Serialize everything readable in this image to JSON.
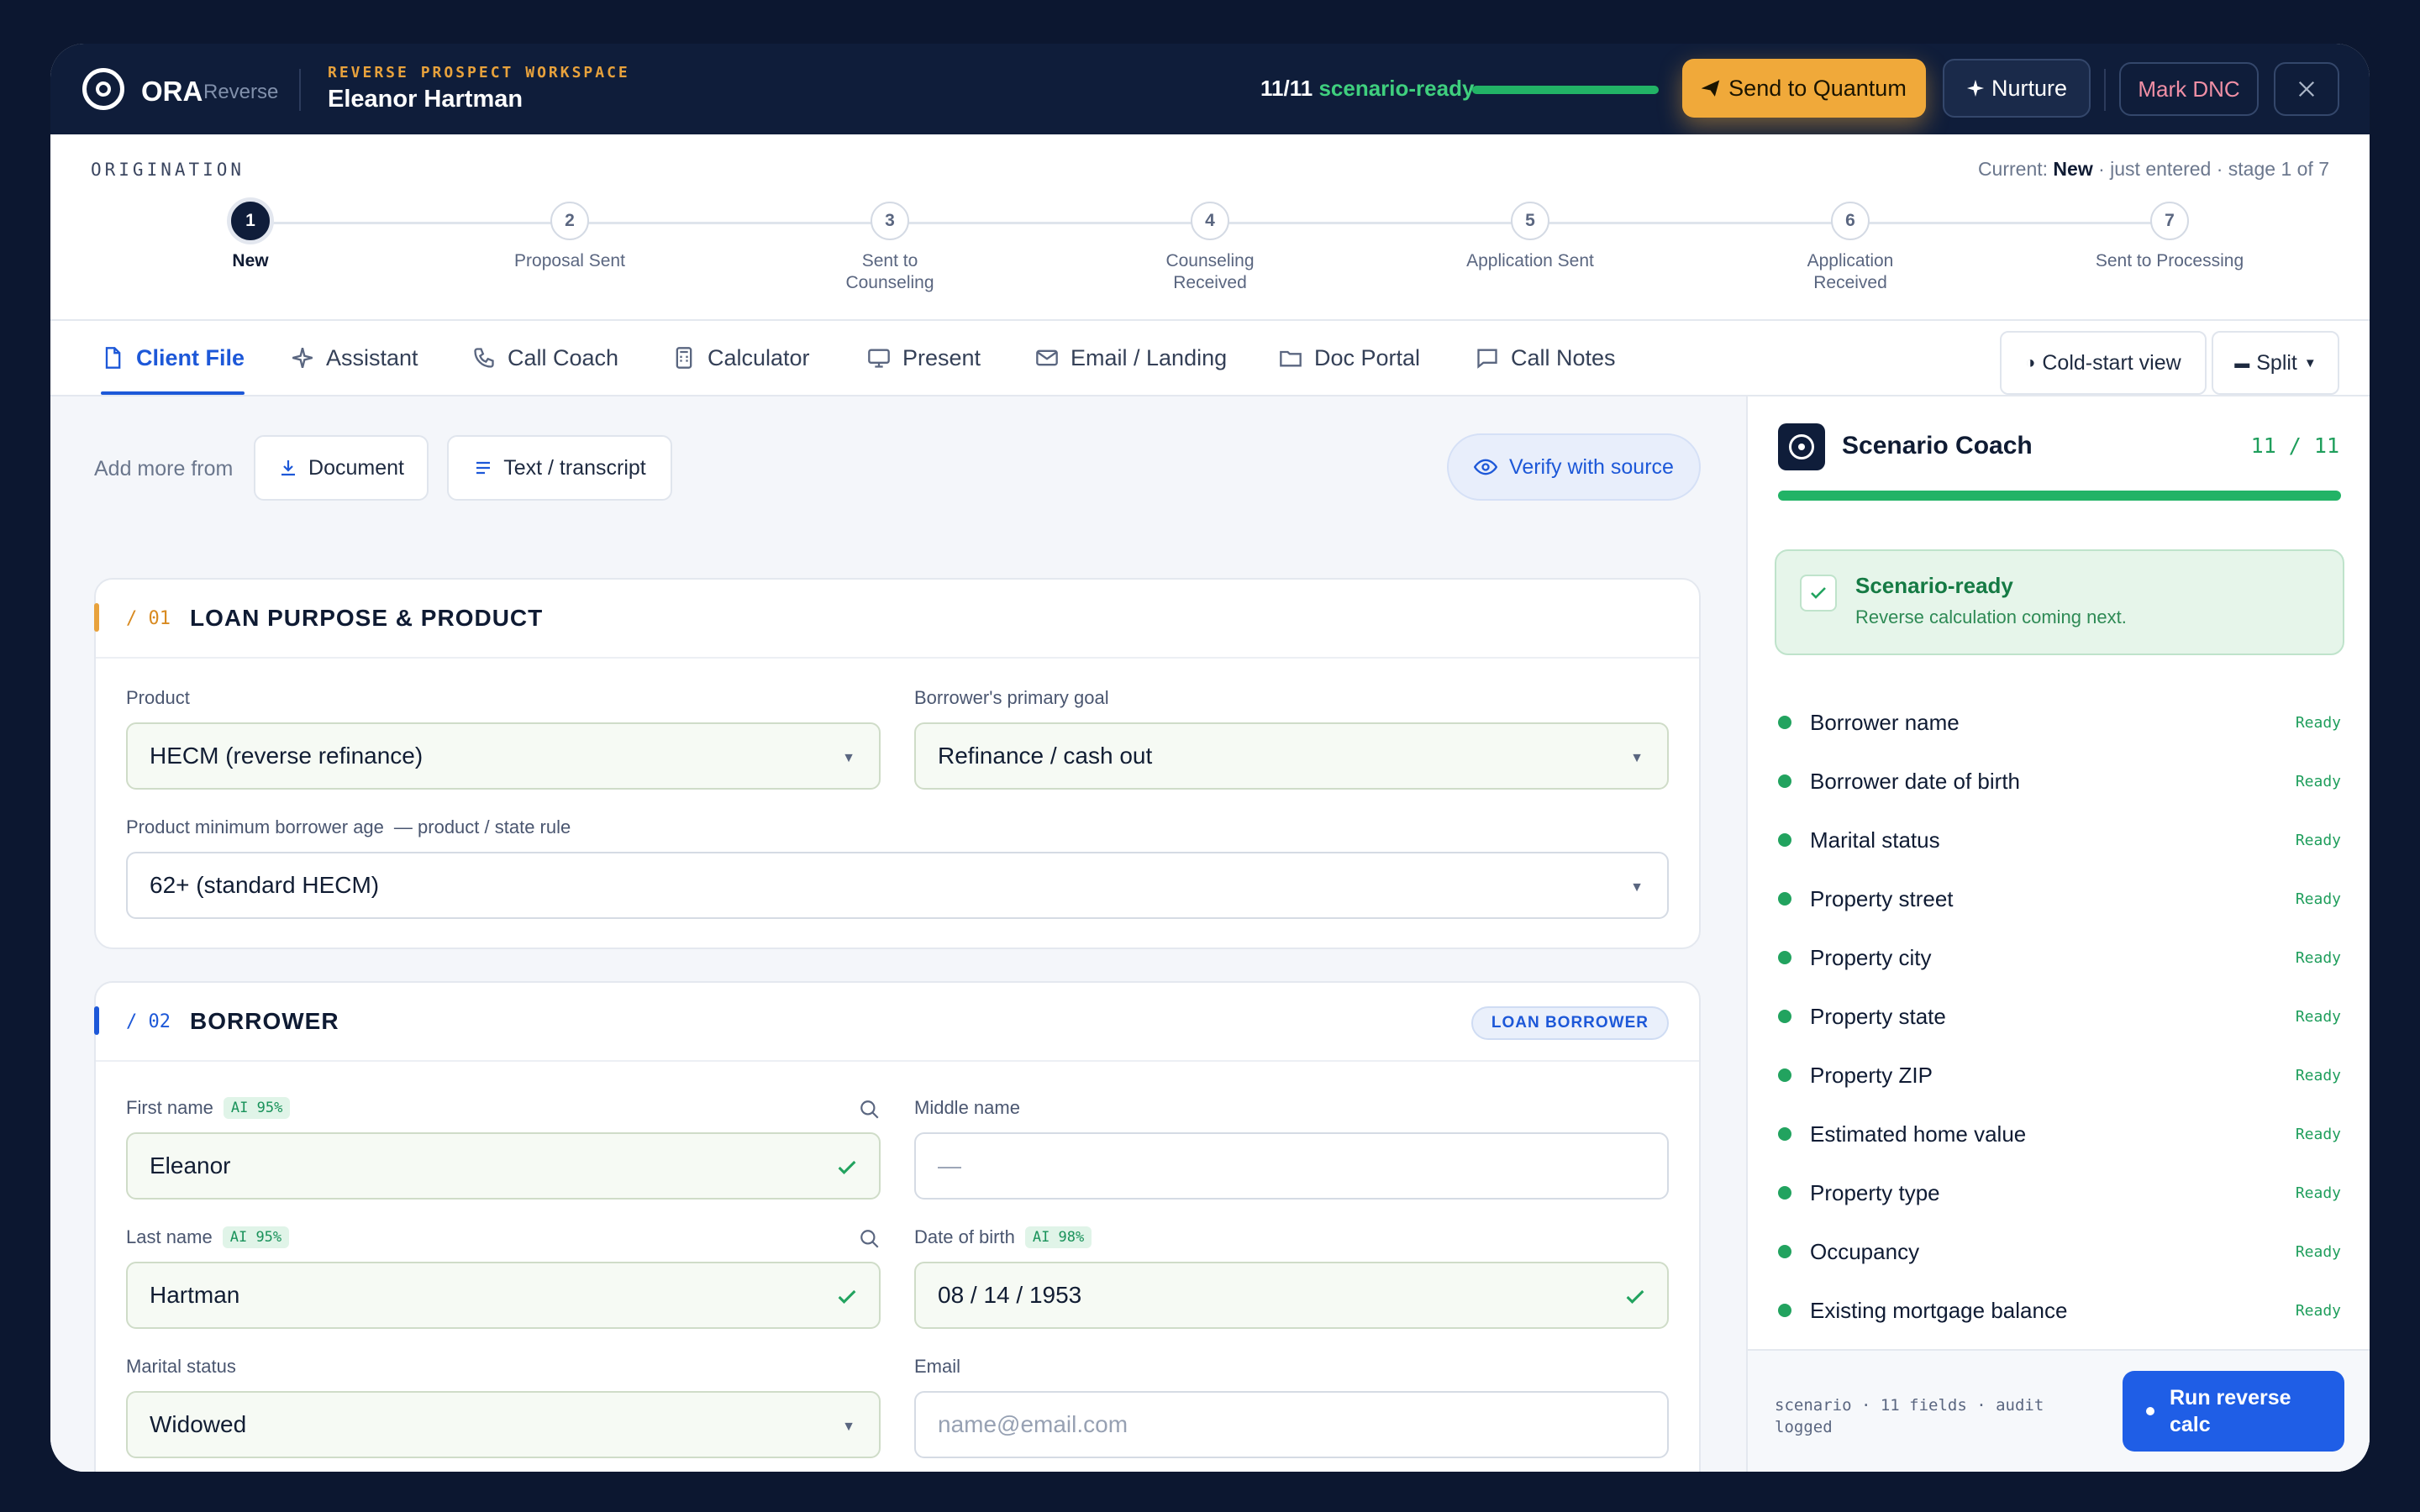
{
  "header": {
    "brand": "ORA",
    "brand_sub": "Reverse",
    "workspace_label": "REVERSE PROSPECT WORKSPACE",
    "client_name": "Eleanor Hartman",
    "ready_count": "11/11",
    "ready_label": "scenario-ready",
    "ready_progress": 1.0,
    "send_label": "Send to Quantum",
    "nurture_label": "Nurture",
    "dnc_label": "Mark DNC"
  },
  "origination": {
    "label": "ORIGINATION",
    "current_prefix": "Current:",
    "current_stage": "New",
    "current_suffix": "· just entered · stage 1 of 7",
    "steps": [
      {
        "n": "1",
        "label": "New"
      },
      {
        "n": "2",
        "label": "Proposal Sent"
      },
      {
        "n": "3",
        "label": "Sent to\nCounseling"
      },
      {
        "n": "4",
        "label": "Counseling\nReceived"
      },
      {
        "n": "5",
        "label": "Application Sent"
      },
      {
        "n": "6",
        "label": "Application\nReceived"
      },
      {
        "n": "7",
        "label": "Sent to Processing"
      }
    ]
  },
  "tabs": [
    "Client File",
    "Assistant",
    "Call Coach",
    "Calculator",
    "Present",
    "Email / Landing",
    "Doc Portal",
    "Call Notes"
  ],
  "view": {
    "cold_start": "Cold-start view",
    "split": "Split"
  },
  "toolbar": {
    "add_more": "Add more from",
    "document": "Document",
    "text": "Text / transcript",
    "verify": "Verify with source"
  },
  "section1": {
    "num": "/ 01",
    "title": "LOAN PURPOSE & PRODUCT",
    "product_label": "Product",
    "product_value": "HECM (reverse refinance)",
    "goal_label": "Borrower's primary goal",
    "goal_value": "Refinance / cash out",
    "minage_label": "Product minimum borrower age",
    "minage_note": "— product / state rule",
    "minage_value": "62+ (standard HECM)"
  },
  "section2": {
    "num": "/ 02",
    "title": "BORROWER",
    "badge": "LOAN BORROWER",
    "first_label": "First name",
    "first_ai": "AI 95%",
    "first_value": "Eleanor",
    "middle_label": "Middle name",
    "middle_value": "—",
    "last_label": "Last name",
    "last_ai": "AI 95%",
    "last_value": "Hartman",
    "dob_label": "Date of birth",
    "dob_ai": "AI 98%",
    "dob_value": "08 / 14 / 1953",
    "marital_label": "Marital status",
    "marital_value": "Widowed",
    "email_label": "Email",
    "email_placeholder": "name@email.com"
  },
  "coach": {
    "title": "Scenario Coach",
    "count": "11 / 11",
    "progress": 1.0,
    "ready_title": "Scenario-ready",
    "ready_sub": "Reverse calculation coming next.",
    "items": [
      {
        "name": "Borrower name",
        "status": "Ready"
      },
      {
        "name": "Borrower date of birth",
        "status": "Ready"
      },
      {
        "name": "Marital status",
        "status": "Ready"
      },
      {
        "name": "Property street",
        "status": "Ready"
      },
      {
        "name": "Property city",
        "status": "Ready"
      },
      {
        "name": "Property state",
        "status": "Ready"
      },
      {
        "name": "Property ZIP",
        "status": "Ready"
      },
      {
        "name": "Estimated home value",
        "status": "Ready"
      },
      {
        "name": "Property type",
        "status": "Ready"
      },
      {
        "name": "Occupancy",
        "status": "Ready"
      },
      {
        "name": "Existing mortgage balance",
        "status": "Ready"
      }
    ],
    "footer_meta": "scenario · 11 fields · audit logged",
    "run_label": "Run reverse calc"
  },
  "colors": {
    "accent": "#1d58d8",
    "gold": "#f0a93a",
    "green": "#22b366",
    "navy": "#0f1d3a"
  }
}
